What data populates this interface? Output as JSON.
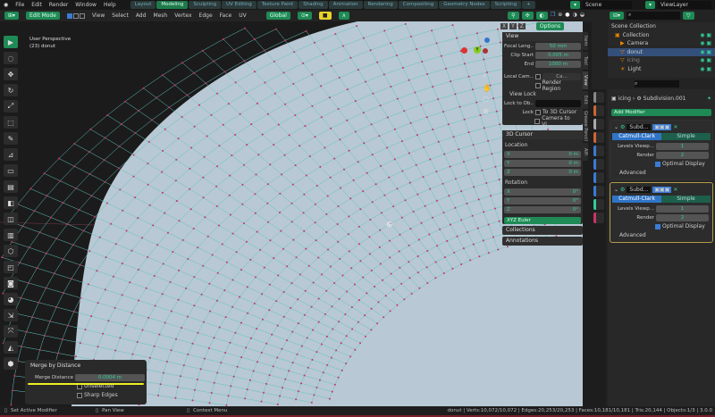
{
  "menu": [
    "File",
    "Edit",
    "Render",
    "Window",
    "Help"
  ],
  "workspaces": [
    "Layout",
    "Modeling",
    "Sculpting",
    "UV Editing",
    "Texture Paint",
    "Shading",
    "Animation",
    "Rendering",
    "Compositing",
    "Geometry Nodes",
    "Scripting",
    "+"
  ],
  "active_workspace": 1,
  "scene": "Scene",
  "view_layer": "ViewLayer",
  "header": {
    "mode": "Edit Mode",
    "menus": [
      "View",
      "Select",
      "Add",
      "Mesh",
      "Vertex",
      "Edge",
      "Face",
      "UV"
    ],
    "orientation": "Global",
    "options": "Options"
  },
  "viewport": {
    "perspective": "User Perspective",
    "object": "(23) donut",
    "axes": [
      "X",
      "Y",
      "Z"
    ]
  },
  "npanel": {
    "view_title": "View",
    "focal_label": "Focal Leng...",
    "focal": "50 mm",
    "clip_start_label": "Clip Start",
    "clip_start": "0.005 m",
    "end_label": "End",
    "end": "1000 m",
    "local_cam_label": "Local Cam...",
    "local_cam": "Ca...",
    "render_region": "Render Region",
    "view_lock": "View Lock",
    "lock_obj_label": "Lock to Ob...",
    "lock_label": "Lock",
    "to_cursor": "To 3D Cursor",
    "camera_to_view": "Camera to Vi...",
    "cursor_title": "3D Cursor",
    "location": "Location",
    "rotation": "Rotation",
    "loc": [
      {
        "axis": "X",
        "value": "0 m"
      },
      {
        "axis": "Y",
        "value": "0 m"
      },
      {
        "axis": "Z",
        "value": "0 m"
      }
    ],
    "rot": [
      {
        "axis": "X",
        "value": "0°"
      },
      {
        "axis": "Y",
        "value": "0°"
      },
      {
        "axis": "Z",
        "value": "0°"
      }
    ],
    "rot_mode": "XYZ Euler",
    "collections": "Collections",
    "annotations": "Annotations"
  },
  "tabs": [
    "Item",
    "Tool",
    "View",
    "Edit",
    "Grease Pencil",
    "Alfi"
  ],
  "outliner": {
    "root": "Scene Collection",
    "items": [
      "Collection",
      "Camera",
      "donut",
      "icing",
      "Light"
    ]
  },
  "properties": {
    "object": "icing",
    "modifier_path": "Subdivision.001",
    "add_modifier": "Add Modifier",
    "modifiers": [
      {
        "name": "Subd...",
        "types": [
          "Catmull-Clark",
          "Simple"
        ],
        "levels_label": "Levels Viewp...",
        "levels": "1",
        "render_label": "Render",
        "render": "2",
        "optimal": "Optimal Display",
        "advanced": "Advanced"
      },
      {
        "name": "Subd...",
        "types": [
          "Catmull-Clark",
          "Simple"
        ],
        "levels_label": "Levels Viewp...",
        "levels": "1",
        "render_label": "Render",
        "render": "2",
        "optimal": "Optimal Display",
        "advanced": "Advanced"
      }
    ]
  },
  "operator": {
    "title": "Merge by Distance",
    "distance_label": "Merge Distance",
    "distance": "0.0004 m",
    "unselected": "Unselected",
    "sharp": "Sharp Edges"
  },
  "status": {
    "left": "Set Active Modifier",
    "middle": "Pan View",
    "right": "Context Menu",
    "stats": "donut | Verts:10,072/10,072 | Edges:20,253/20,253 | Faces:10,181/10,181 | Tris:20,144 | Objects:1/3 | 3.0.0"
  },
  "colors": {
    "accent": "#1f8a55",
    "vertex": "#d0306a",
    "wire": "#5fc6c0",
    "mesh": "#b8c8d4"
  }
}
